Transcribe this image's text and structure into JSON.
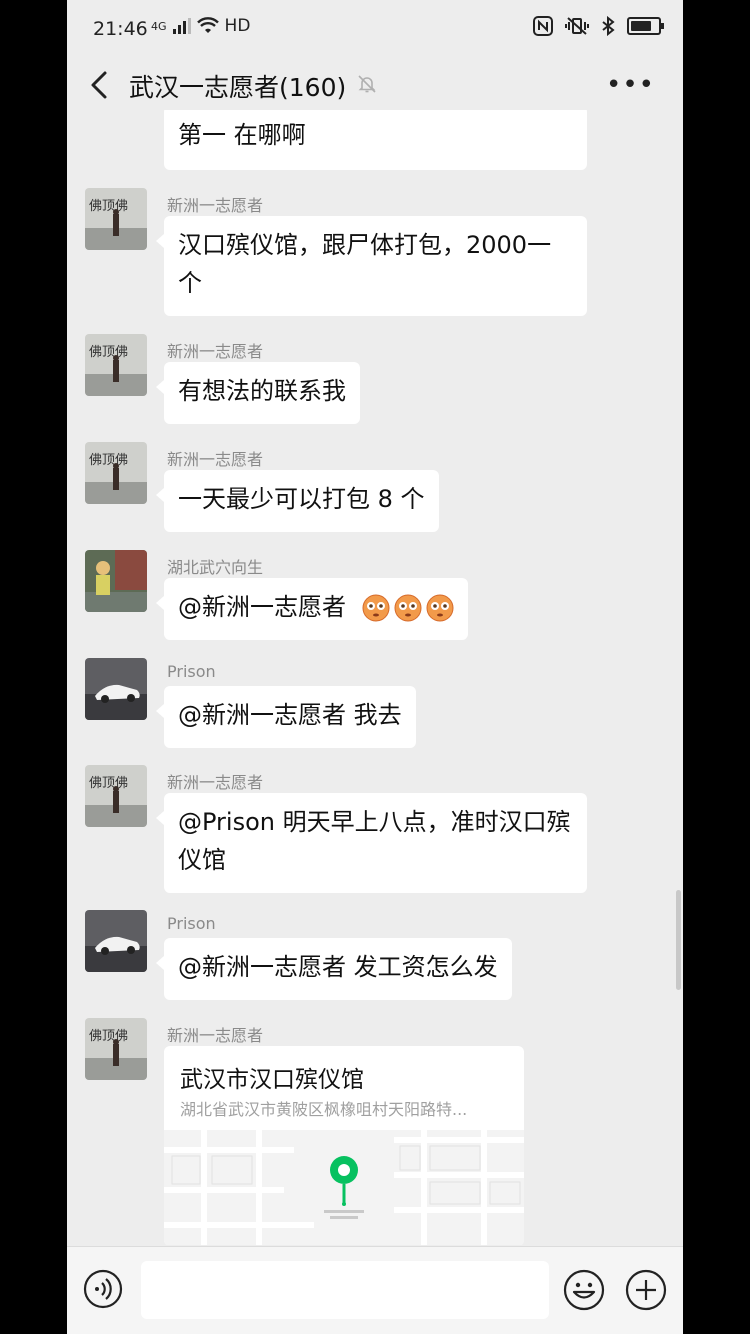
{
  "status_bar": {
    "time": "21:46",
    "network": "4G",
    "hd": "HD"
  },
  "nav": {
    "title": "武汉一志愿者(160)"
  },
  "messages": [
    {
      "text": "第一  在哪啊"
    },
    {
      "sender": "新洲一志愿者",
      "text": "汉口殡仪馆，跟尸体打包，2000一个"
    },
    {
      "sender": "新洲一志愿者",
      "text": "有想法的联系我"
    },
    {
      "sender": "新洲一志愿者",
      "text": "一天最少可以打包 8 个"
    },
    {
      "sender": "湖北武穴向生",
      "text": "@新洲一志愿者"
    },
    {
      "sender": "Prison",
      "text": "@新洲一志愿者  我去"
    },
    {
      "sender": "新洲一志愿者",
      "text": "@Prison  明天早上八点，准时汉口殡仪馆"
    },
    {
      "sender": "Prison",
      "text": "@新洲一志愿者  发工资怎么发"
    },
    {
      "sender": "新洲一志愿者",
      "location": {
        "title": "武汉市汉口殡仪馆",
        "address": "湖北省武汉市黄陂区枫橡咀村天阳路特..."
      }
    }
  ],
  "avatar_text": "佛顶佛",
  "colors": {
    "background": "#ededed",
    "bubble": "#ffffff",
    "accent_green": "#07c160"
  }
}
